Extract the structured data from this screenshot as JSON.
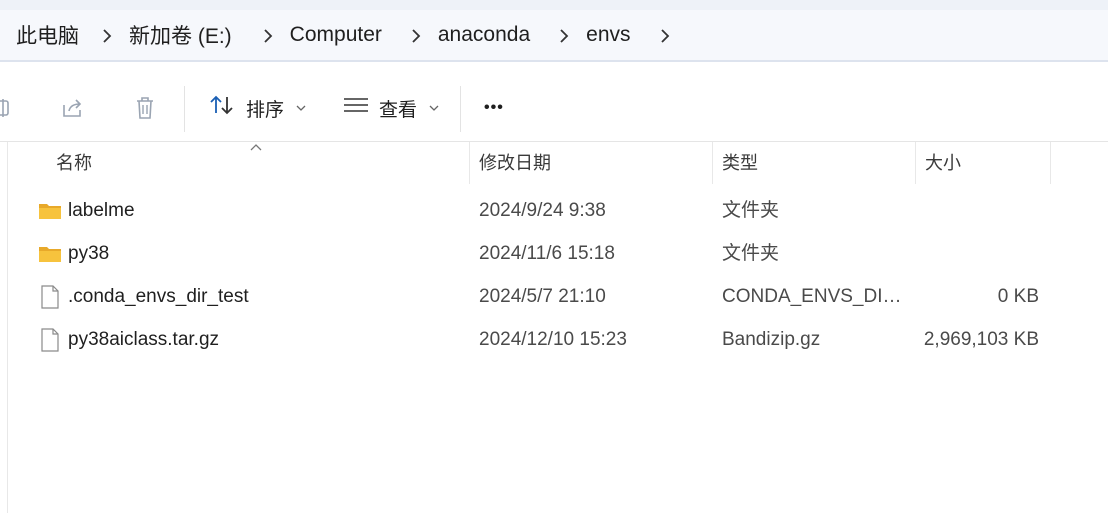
{
  "breadcrumb": {
    "items": [
      {
        "label": "此电脑"
      },
      {
        "label": "新加卷 (E:)"
      },
      {
        "label": "Computer"
      },
      {
        "label": "anaconda"
      },
      {
        "label": "envs"
      }
    ],
    "chevron": ">"
  },
  "toolbar": {
    "sort_label": "排序",
    "view_label": "查看",
    "more_label": "•••",
    "icons": [
      "rename-icon",
      "share-icon",
      "delete-icon",
      "sort-icon",
      "view-icon",
      "more-icon"
    ]
  },
  "columns": {
    "name": "名称",
    "date": "修改日期",
    "type": "类型",
    "size": "大小"
  },
  "files": [
    {
      "name": "labelme",
      "date": "2024/9/24 9:38",
      "type": "文件夹",
      "size": "",
      "icon": "folder-icon"
    },
    {
      "name": "py38",
      "date": "2024/11/6 15:18",
      "type": "文件夹",
      "size": "",
      "icon": "folder-icon"
    },
    {
      "name": ".conda_envs_dir_test",
      "date": "2024/5/7 21:10",
      "type": "CONDA_ENVS_DIR...",
      "size": "0 KB",
      "icon": "file-icon"
    },
    {
      "name": "py38aiclass.tar.gz",
      "date": "2024/12/10 15:23",
      "type": "Bandizip.gz",
      "size": "2,969,103 KB",
      "icon": "file-icon"
    }
  ],
  "colors": {
    "address_bg": "#f6f8fc",
    "folder_yellow": "#f7c33d",
    "icon_gray": "#9aa4b2",
    "accent_blue": "#1a5fb4"
  }
}
